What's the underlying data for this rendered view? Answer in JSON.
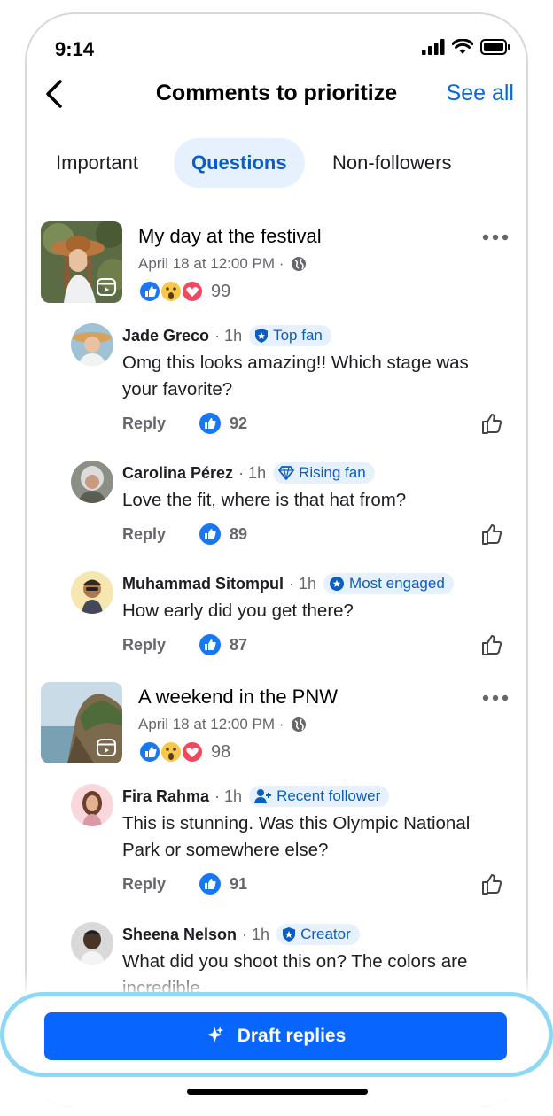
{
  "status": {
    "time": "9:14"
  },
  "header": {
    "title": "Comments to prioritize",
    "see_all": "See all"
  },
  "tabs": [
    {
      "label": "Important",
      "active": false
    },
    {
      "label": "Questions",
      "active": true
    },
    {
      "label": "Non-followers",
      "active": false
    }
  ],
  "posts": [
    {
      "title": "My day at the festival",
      "date": "April 18 at 12:00 PM ·",
      "reactions": "99",
      "comments": [
        {
          "name": "Jade Greco",
          "time": "· 1h",
          "badge": "Top fan",
          "badge_icon": "shield-icon",
          "text": "Omg this looks amazing!! Which stage was your favorite?",
          "reply": "Reply",
          "likes": "92"
        },
        {
          "name": "Carolina Pérez",
          "time": "· 1h",
          "badge": "Rising fan",
          "badge_icon": "diamond-icon",
          "text": "Love the fit, where is that hat from?",
          "reply": "Reply",
          "likes": "89"
        },
        {
          "name": "Muhammad Sitompul",
          "time": "· 1h",
          "badge": "Most engaged",
          "badge_icon": "star-badge-icon",
          "text": "How early did you get there?",
          "reply": "Reply",
          "likes": "87"
        }
      ]
    },
    {
      "title": "A weekend in the PNW",
      "date": "April 18 at 12:00 PM ·",
      "reactions": "98",
      "comments": [
        {
          "name": "Fira Rahma",
          "time": "· 1h",
          "badge": "Recent follower",
          "badge_icon": "person-add-icon",
          "text": "This is stunning. Was this Olympic National Park or somewhere else?",
          "reply": "Reply",
          "likes": "91"
        },
        {
          "name": "Sheena Nelson",
          "time": "· 1h",
          "badge": "Creator",
          "badge_icon": "shield-icon",
          "text": "What did you shoot this on? The colors are incredible",
          "reply": "",
          "likes": ""
        }
      ]
    }
  ],
  "footer": {
    "draft_label": "Draft replies"
  },
  "colors": {
    "accent": "#0866ff",
    "link": "#0a66e0",
    "badge_bg": "#e7f1fd",
    "highlight": "#8ed8f5"
  }
}
